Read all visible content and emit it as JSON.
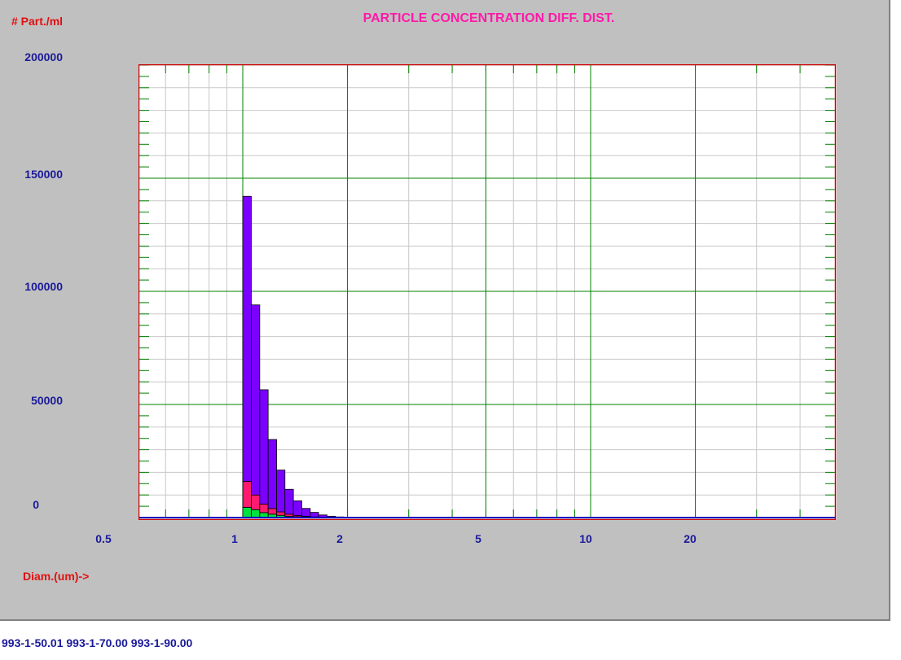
{
  "chart_data": {
    "type": "bar",
    "title": "PARTICLE CONCENTRATION DIFF. DIST.",
    "ylabel": "# Part./ml",
    "xlabel": "Diam.(um)->",
    "x_scale": "log",
    "xlim": [
      0.5,
      42
    ],
    "ylim": [
      0,
      200000
    ],
    "y_tick_labels": [
      "200000",
      "150000",
      "100000",
      "50000",
      "0"
    ],
    "y_ticks": [
      200000,
      150000,
      100000,
      50000,
      0
    ],
    "x_tick_labels": [
      "0.5",
      "1",
      "2",
      "5",
      "10",
      "20"
    ],
    "x_ticks": [
      0.5,
      1,
      2,
      5,
      10,
      20
    ],
    "stacked": true,
    "bin_edges": [
      1.0,
      1.058,
      1.119,
      1.183,
      1.251,
      1.322,
      1.398,
      1.478,
      1.563,
      1.652,
      1.747,
      1.847,
      1.952,
      2.064,
      2.182,
      2.306,
      2.438
    ],
    "series": [
      {
        "color": "#00e040",
        "values": [
          4500,
          3500,
          2200,
          1500,
          1000,
          600,
          400,
          250,
          150,
          80,
          50,
          20,
          10,
          5,
          3,
          2
        ]
      },
      {
        "color": "#ff1a70",
        "values": [
          11500,
          6500,
          3800,
          2500,
          1500,
          900,
          500,
          300,
          150,
          80,
          40,
          20,
          10,
          5,
          2,
          1
        ]
      },
      {
        "color": "#7a00ff",
        "values": [
          126000,
          84000,
          50500,
          30500,
          18500,
          11000,
          6500,
          3500,
          2000,
          1000,
          500,
          250,
          130,
          60,
          30,
          15
        ]
      }
    ],
    "colors": {
      "background": "#c0c0c0",
      "plot_area": "#ffffff",
      "major_grid": "#008000",
      "minor_grid": "#c8c8c8",
      "frame": "#cc0000",
      "axis_text": "#1a1a9a",
      "unit_text": "#e01010",
      "title_text": "#ff1aa8",
      "baseline": "#0000c0"
    }
  },
  "legend_text": "993-1-50.01 993-1-70.00 993-1-90.00"
}
